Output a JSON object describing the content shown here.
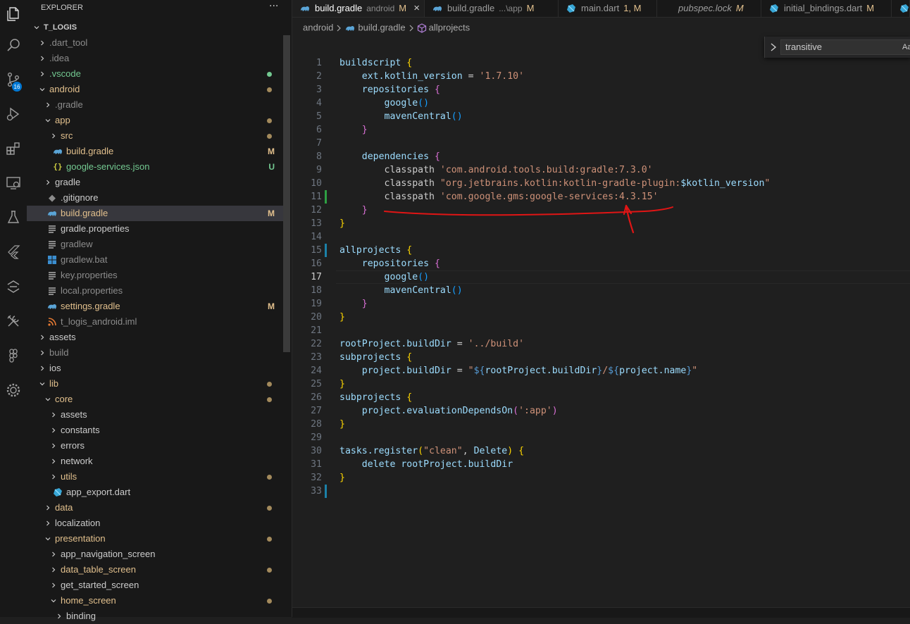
{
  "activity_bar": {
    "items": [
      {
        "name": "explorer-icon"
      },
      {
        "name": "search-icon"
      },
      {
        "name": "source-control-icon",
        "badge": "16"
      },
      {
        "name": "run-debug-icon"
      },
      {
        "name": "extensions-icon"
      },
      {
        "name": "remote-explorer-icon"
      },
      {
        "name": "testing-icon"
      },
      {
        "name": "flutter-icon"
      },
      {
        "name": "dart-devtools-icon"
      },
      {
        "name": "tools-icon"
      },
      {
        "name": "figma-icon"
      },
      {
        "name": "settings-gear-icon"
      }
    ]
  },
  "explorer": {
    "title": "EXPLORER",
    "more_label": "···",
    "root": "T_LOGIS",
    "items": [
      {
        "label": "T_LOGIS",
        "depth": 0,
        "kind": "folder-open",
        "color": "#cccccc",
        "bold": true
      },
      {
        "label": ".dart_tool",
        "depth": 1,
        "kind": "folder",
        "color": "#8c8c8c"
      },
      {
        "label": ".idea",
        "depth": 1,
        "kind": "folder",
        "color": "#8c8c8c"
      },
      {
        "label": ".vscode",
        "depth": 1,
        "kind": "folder",
        "color": "#73c991",
        "dot": "#73c991"
      },
      {
        "label": "android",
        "depth": 1,
        "kind": "folder-open",
        "color": "#e2c08d",
        "dot": "#a38a5c"
      },
      {
        "label": ".gradle",
        "depth": 2,
        "kind": "folder",
        "color": "#8c8c8c"
      },
      {
        "label": "app",
        "depth": 2,
        "kind": "folder-open",
        "color": "#e2c08d",
        "dot": "#a38a5c"
      },
      {
        "label": "src",
        "depth": 3,
        "kind": "folder",
        "color": "#e2c08d",
        "dot": "#a38a5c"
      },
      {
        "label": "build.gradle",
        "depth": 3,
        "kind": "gradle",
        "color": "#e2c08d",
        "deco": "M"
      },
      {
        "label": "google-services.json",
        "depth": 3,
        "kind": "json",
        "color": "#73c991",
        "deco": "U"
      },
      {
        "label": "gradle",
        "depth": 2,
        "kind": "folder",
        "color": "#cccccc"
      },
      {
        "label": ".gitignore",
        "depth": 2,
        "kind": "gitignore",
        "color": "#cccccc"
      },
      {
        "label": "build.gradle",
        "depth": 2,
        "kind": "gradle",
        "color": "#e2c08d",
        "deco": "M",
        "selected": true
      },
      {
        "label": "gradle.properties",
        "depth": 2,
        "kind": "lines",
        "color": "#cccccc"
      },
      {
        "label": "gradlew",
        "depth": 2,
        "kind": "lines",
        "color": "#8c8c8c"
      },
      {
        "label": "gradlew.bat",
        "depth": 2,
        "kind": "windows",
        "color": "#8c8c8c"
      },
      {
        "label": "key.properties",
        "depth": 2,
        "kind": "lines",
        "color": "#8c8c8c"
      },
      {
        "label": "local.properties",
        "depth": 2,
        "kind": "lines",
        "color": "#8c8c8c"
      },
      {
        "label": "settings.gradle",
        "depth": 2,
        "kind": "gradle",
        "color": "#e2c08d",
        "deco": "M"
      },
      {
        "label": "t_logis_android.iml",
        "depth": 2,
        "kind": "rss",
        "color": "#8c8c8c"
      },
      {
        "label": "assets",
        "depth": 1,
        "kind": "folder",
        "color": "#cccccc"
      },
      {
        "label": "build",
        "depth": 1,
        "kind": "folder",
        "color": "#8c8c8c"
      },
      {
        "label": "ios",
        "depth": 1,
        "kind": "folder",
        "color": "#cccccc"
      },
      {
        "label": "lib",
        "depth": 1,
        "kind": "folder-open",
        "color": "#e2c08d",
        "dot": "#a38a5c"
      },
      {
        "label": "core",
        "depth": 2,
        "kind": "folder-open",
        "color": "#e2c08d",
        "dot": "#a38a5c"
      },
      {
        "label": "assets",
        "depth": 3,
        "kind": "folder",
        "color": "#cccccc"
      },
      {
        "label": "constants",
        "depth": 3,
        "kind": "folder",
        "color": "#cccccc"
      },
      {
        "label": "errors",
        "depth": 3,
        "kind": "folder",
        "color": "#cccccc"
      },
      {
        "label": "network",
        "depth": 3,
        "kind": "folder",
        "color": "#cccccc"
      },
      {
        "label": "utils",
        "depth": 3,
        "kind": "folder",
        "color": "#e2c08d",
        "dot": "#a38a5c"
      },
      {
        "label": "app_export.dart",
        "depth": 3,
        "kind": "dart",
        "color": "#cccccc"
      },
      {
        "label": "data",
        "depth": 2,
        "kind": "folder",
        "color": "#e2c08d",
        "dot": "#a38a5c"
      },
      {
        "label": "localization",
        "depth": 2,
        "kind": "folder",
        "color": "#cccccc"
      },
      {
        "label": "presentation",
        "depth": 2,
        "kind": "folder-open",
        "color": "#e2c08d",
        "dot": "#a38a5c"
      },
      {
        "label": "app_navigation_screen",
        "depth": 3,
        "kind": "folder",
        "color": "#cccccc"
      },
      {
        "label": "data_table_screen",
        "depth": 3,
        "kind": "folder",
        "color": "#e2c08d",
        "dot": "#a38a5c"
      },
      {
        "label": "get_started_screen",
        "depth": 3,
        "kind": "folder",
        "color": "#cccccc"
      },
      {
        "label": "home_screen",
        "depth": 3,
        "kind": "folder-open",
        "color": "#e2c08d",
        "dot": "#a38a5c"
      },
      {
        "label": "binding",
        "depth": 4,
        "kind": "folder",
        "color": "#cccccc"
      }
    ]
  },
  "tabs": [
    {
      "label": "build.gradle",
      "desc": "android",
      "mod": "M",
      "icon": "gradle-icon",
      "active": true,
      "close": "×"
    },
    {
      "label": "build.gradle",
      "desc": "...\\app",
      "mod": "M",
      "icon": "gradle-icon"
    },
    {
      "label": "main.dart",
      "desc": "",
      "mod": "1, M",
      "icon": "dart-icon"
    },
    {
      "label": "pubspec.lock",
      "desc": "",
      "mod": "M",
      "icon": "",
      "italic": true
    },
    {
      "label": "initial_bindings.dart",
      "desc": "",
      "mod": "M",
      "icon": "dart-icon"
    },
    {
      "label": "",
      "desc": "",
      "mod": "",
      "icon": "dart-icon"
    }
  ],
  "breadcrumb": {
    "parts": [
      "android",
      "build.gradle",
      "allprojects"
    ]
  },
  "find": {
    "value": "transitive",
    "match_case": "Aa"
  },
  "editor": {
    "current_line": 17,
    "lines": [
      [
        {
          "t": "buildscript ",
          "c": "k"
        },
        {
          "t": "{",
          "c": "b1"
        }
      ],
      [
        {
          "t": "    ext.kotlin_version ",
          "c": "k"
        },
        {
          "t": "= ",
          "c": "p"
        },
        {
          "t": "'1.7.10'",
          "c": "s"
        }
      ],
      [
        {
          "t": "    repositories ",
          "c": "k"
        },
        {
          "t": "{",
          "c": "b2"
        }
      ],
      [
        {
          "t": "        google",
          "c": "k"
        },
        {
          "t": "()",
          "c": "b3"
        }
      ],
      [
        {
          "t": "        mavenCentral",
          "c": "k"
        },
        {
          "t": "()",
          "c": "b3"
        }
      ],
      [
        {
          "t": "    ",
          "c": "p"
        },
        {
          "t": "}",
          "c": "b2"
        }
      ],
      [],
      [
        {
          "t": "    dependencies ",
          "c": "k"
        },
        {
          "t": "{",
          "c": "b2"
        }
      ],
      [
        {
          "t": "        classpath ",
          "c": "p"
        },
        {
          "t": "'com.android.tools.build:gradle:7.3.0'",
          "c": "s"
        }
      ],
      [
        {
          "t": "        classpath ",
          "c": "p"
        },
        {
          "t": "\"org.jetbrains.kotlin:kotlin-gradle-plugin:",
          "c": "s"
        },
        {
          "t": "$kotlin_version",
          "c": "k"
        },
        {
          "t": "\"",
          "c": "s"
        }
      ],
      [
        {
          "t": "        classpath ",
          "c": "p"
        },
        {
          "t": "'com.google.gms:google-services:4.3.15'",
          "c": "s"
        }
      ],
      [
        {
          "t": "    ",
          "c": "p"
        },
        {
          "t": "}",
          "c": "b2"
        }
      ],
      [
        {
          "t": "}",
          "c": "b1"
        }
      ],
      [],
      [
        {
          "t": "allprojects ",
          "c": "k"
        },
        {
          "t": "{",
          "c": "b1"
        }
      ],
      [
        {
          "t": "    repositories ",
          "c": "k"
        },
        {
          "t": "{",
          "c": "b2"
        }
      ],
      [
        {
          "t": "        google",
          "c": "k"
        },
        {
          "t": "()",
          "c": "b3"
        }
      ],
      [
        {
          "t": "        mavenCentral",
          "c": "k"
        },
        {
          "t": "()",
          "c": "b3"
        }
      ],
      [
        {
          "t": "    ",
          "c": "p"
        },
        {
          "t": "}",
          "c": "b2"
        }
      ],
      [
        {
          "t": "}",
          "c": "b1"
        }
      ],
      [],
      [
        {
          "t": "rootProject.buildDir ",
          "c": "k"
        },
        {
          "t": "= ",
          "c": "p"
        },
        {
          "t": "'../build'",
          "c": "s"
        }
      ],
      [
        {
          "t": "subprojects ",
          "c": "k"
        },
        {
          "t": "{",
          "c": "b1"
        }
      ],
      [
        {
          "t": "    project.buildDir ",
          "c": "k"
        },
        {
          "t": "= ",
          "c": "p"
        },
        {
          "t": "\"",
          "c": "s"
        },
        {
          "t": "${",
          "c": "kw"
        },
        {
          "t": "rootProject.buildDir",
          "c": "k"
        },
        {
          "t": "}",
          "c": "kw"
        },
        {
          "t": "/",
          "c": "s"
        },
        {
          "t": "${",
          "c": "kw"
        },
        {
          "t": "project.name",
          "c": "k"
        },
        {
          "t": "}",
          "c": "kw"
        },
        {
          "t": "\"",
          "c": "s"
        }
      ],
      [
        {
          "t": "}",
          "c": "b1"
        }
      ],
      [
        {
          "t": "subprojects ",
          "c": "k"
        },
        {
          "t": "{",
          "c": "b1"
        }
      ],
      [
        {
          "t": "    project.evaluationDependsOn",
          "c": "k"
        },
        {
          "t": "(",
          "c": "b2"
        },
        {
          "t": "':app'",
          "c": "s"
        },
        {
          "t": ")",
          "c": "b2"
        }
      ],
      [
        {
          "t": "}",
          "c": "b1"
        }
      ],
      [],
      [
        {
          "t": "tasks.register",
          "c": "k"
        },
        {
          "t": "(",
          "c": "b1"
        },
        {
          "t": "\"clean\"",
          "c": "s"
        },
        {
          "t": ", ",
          "c": "p"
        },
        {
          "t": "Delete",
          "c": "k"
        },
        {
          "t": ") ",
          "c": "b1"
        },
        {
          "t": "{",
          "c": "b1"
        }
      ],
      [
        {
          "t": "    delete ",
          "c": "k"
        },
        {
          "t": "rootProject.buildDir",
          "c": "k"
        }
      ],
      [
        {
          "t": "}",
          "c": "b1"
        }
      ],
      []
    ],
    "gutter_marks": [
      {
        "line": 11,
        "color": "#2ea043"
      },
      {
        "line": 15,
        "color": "#1b81a8"
      },
      {
        "line": 33,
        "color": "#1b81a8"
      }
    ]
  }
}
